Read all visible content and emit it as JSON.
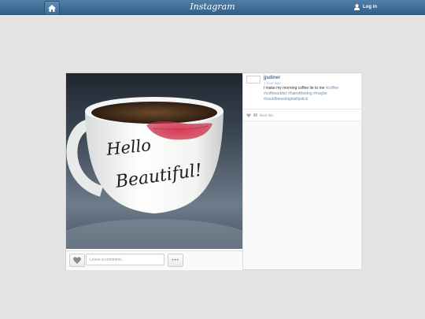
{
  "header": {
    "brand": "Instagram",
    "login_label": "Log in",
    "icons": {
      "home": "home-icon",
      "user": "user-icon"
    }
  },
  "post": {
    "username": "jjsdiner",
    "time": "1 hour ago",
    "caption": {
      "text": "i make my morning coffee lie to me",
      "tags": [
        "#coffee",
        "#coffeeaddict",
        "#hairofthedog",
        "#maybe",
        "#couldbelastnightslipstick"
      ]
    },
    "photo": {
      "mug_line1": "Hello",
      "mug_line2": "Beautiful!"
    },
    "likes_label": "liked this",
    "comment_placeholder": "Leave a comment...",
    "more_label": "•••"
  },
  "colors": {
    "topbar": "#3f6d95",
    "link": "#3f729b",
    "hashtag": "#6d8db0",
    "background": "#e3e3e3"
  }
}
